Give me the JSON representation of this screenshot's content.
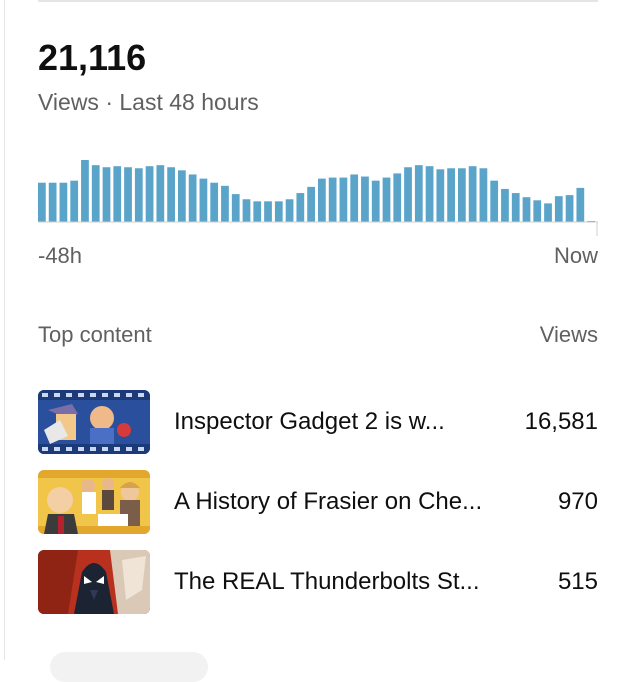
{
  "summary": {
    "total_views": "21,116",
    "period_label": "Views · Last 48 hours"
  },
  "chart_data": {
    "type": "bar",
    "values": [
      38,
      38,
      38,
      40,
      60,
      55,
      53,
      54,
      53,
      52,
      54,
      55,
      53,
      50,
      46,
      42,
      38,
      35,
      27,
      22,
      20,
      20,
      20,
      22,
      28,
      34,
      42,
      43,
      43,
      46,
      44,
      40,
      43,
      47,
      53,
      55,
      54,
      51,
      52,
      52,
      54,
      52,
      40,
      32,
      28,
      24,
      21,
      18,
      25,
      26,
      33,
      1
    ],
    "xlabel_start": "-48h",
    "xlabel_end": "Now",
    "bar_color": "#5aa3c9",
    "grid": false
  },
  "top_content": {
    "header_label": "Top content",
    "header_metric": "Views",
    "items": [
      {
        "title": "Inspector Gadget 2 is w...",
        "views": "16,581"
      },
      {
        "title": "A History of Frasier on Che...",
        "views": "970"
      },
      {
        "title": "The REAL Thunderbolts St...",
        "views": "515"
      }
    ]
  }
}
